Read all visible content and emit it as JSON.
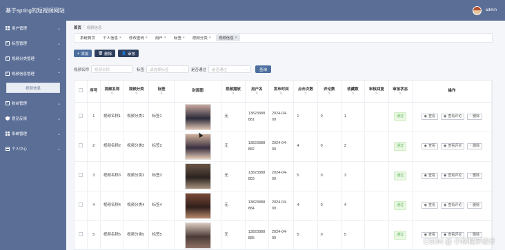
{
  "header": {
    "title": "基于spring的短视频网站",
    "user": "admin"
  },
  "sidebar": {
    "items": [
      {
        "label": "用户管理",
        "icon": "grid-icon"
      },
      {
        "label": "标签管理",
        "icon": "image-icon"
      },
      {
        "label": "视频分类管理",
        "icon": "image-icon"
      },
      {
        "label": "视频信息管理",
        "icon": "image-icon",
        "expanded": true,
        "children": [
          "视频信息"
        ]
      },
      {
        "label": "粉丝管理",
        "icon": "image-icon"
      },
      {
        "label": "意见反馈",
        "icon": "shield-icon"
      },
      {
        "label": "系统管理",
        "icon": "grid-icon"
      },
      {
        "label": "个人中心",
        "icon": "calendar-icon"
      }
    ]
  },
  "breadcrumb": {
    "home": "首页",
    "separator": "/",
    "current": "视频信息"
  },
  "tags": [
    {
      "label": "系统首页",
      "closable": false,
      "active": false
    },
    {
      "label": "个人信息",
      "closable": true,
      "active": false
    },
    {
      "label": "修改密码",
      "closable": true,
      "active": false
    },
    {
      "label": "用户",
      "closable": true,
      "active": false
    },
    {
      "label": "标签",
      "closable": true,
      "active": false
    },
    {
      "label": "视频分类",
      "closable": true,
      "active": false
    },
    {
      "label": "视频信息",
      "closable": true,
      "active": true
    }
  ],
  "toolbar": {
    "add": "添加",
    "delete": "删除",
    "audit": "审核"
  },
  "search": {
    "name_label": "视频名称",
    "name_placeholder": "视频名称",
    "tag_label": "标签",
    "tag_placeholder": "请选择标签",
    "public_label": "是否通过",
    "public_placeholder": "是否通过",
    "button": "查询"
  },
  "table": {
    "columns": [
      "序号",
      "视频名称",
      "视频分类",
      "标签",
      "封面图",
      "视频播放",
      "用户名",
      "发布时间",
      "点击次数",
      "评论数",
      "收藏数",
      "审核回复",
      "审核状态",
      "操作"
    ],
    "rows": [
      {
        "no": "1",
        "name": "视频名称1",
        "category": "视频分类1",
        "tag": "标签1",
        "video": "无",
        "user": "13823888881",
        "time": "2024-04-09",
        "clicks": "1",
        "comments": "0",
        "favorites": "1",
        "reply": "",
        "status": "通过"
      },
      {
        "no": "2",
        "name": "视频名称2",
        "category": "视频分类2",
        "tag": "标签2",
        "video": "无",
        "user": "13823888882",
        "time": "2024-04-09",
        "clicks": "4",
        "comments": "0",
        "favorites": "2",
        "reply": "",
        "status": "通过"
      },
      {
        "no": "3",
        "name": "视频名称3",
        "category": "视频分类3",
        "tag": "标签3",
        "video": "无",
        "user": "13823888883",
        "time": "2024-04-09",
        "clicks": "5",
        "comments": "0",
        "favorites": "3",
        "reply": "",
        "status": "通过"
      },
      {
        "no": "4",
        "name": "视频名称4",
        "category": "视频分类4",
        "tag": "标签4",
        "video": "无",
        "user": "13823888884",
        "time": "2024-04-09",
        "clicks": "4",
        "comments": "0",
        "favorites": "4",
        "reply": "",
        "status": "通过"
      },
      {
        "no": "5",
        "name": "视频名称5",
        "category": "视频分类5",
        "tag": "标签5",
        "video": "无",
        "user": "13823888885",
        "time": "2024-04-09",
        "clicks": "5",
        "comments": "0",
        "favorites": "5",
        "reply": "",
        "status": "通过"
      }
    ],
    "actions": {
      "view": "查看",
      "view_comments": "查看评论",
      "delete": "删除"
    }
  },
  "watermark": "CSDN @ 小林程序设计",
  "colors": {
    "sidebar": "#5a6e96",
    "primary": "#4d6f9f",
    "dark_button": "#2d3f5e",
    "status_green": "#5cb85c"
  }
}
